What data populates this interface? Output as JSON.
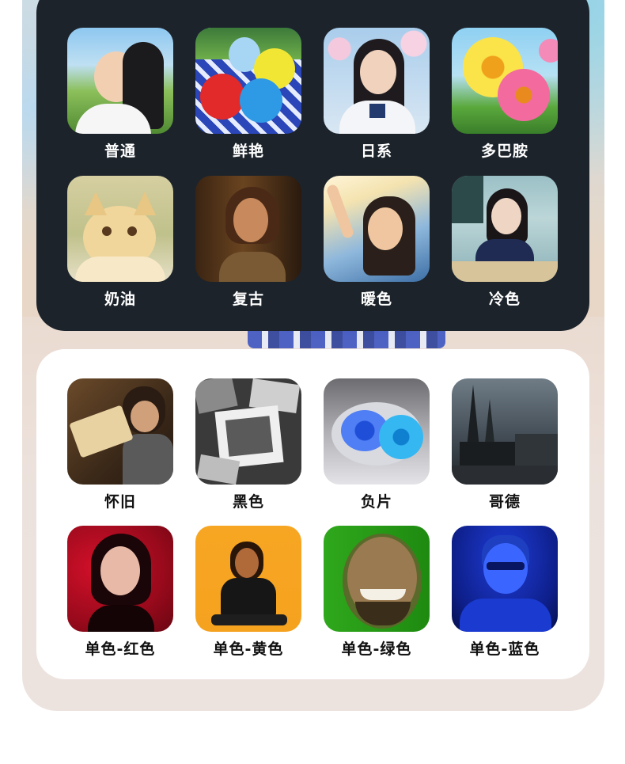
{
  "dark_section": {
    "styles": [
      {
        "label": "普通",
        "icon": "portrait-girl-field-thumbnail"
      },
      {
        "label": "鲜艳",
        "icon": "balloons-picnic-thumbnail"
      },
      {
        "label": "日系",
        "icon": "sakura-girl-thumbnail"
      },
      {
        "label": "多巴胺",
        "icon": "colorful-flowers-thumbnail"
      },
      {
        "label": "奶油",
        "icon": "cream-kitten-thumbnail"
      },
      {
        "label": "复古",
        "icon": "retro-woman-thumbnail"
      },
      {
        "label": "暖色",
        "icon": "warm-sunlight-girl-thumbnail"
      },
      {
        "label": "冷色",
        "icon": "cool-classroom-girl-thumbnail"
      }
    ]
  },
  "light_section": {
    "styles": [
      {
        "label": "怀旧",
        "icon": "nostalgic-reading-woman-thumbnail"
      },
      {
        "label": "黑色",
        "icon": "black-white-photos-thumbnail"
      },
      {
        "label": "负片",
        "icon": "negative-lemon-thumbnail"
      },
      {
        "label": "哥德",
        "icon": "gothic-cathedral-thumbnail"
      },
      {
        "label": "单色-红色",
        "icon": "mono-red-portrait-thumbnail"
      },
      {
        "label": "单色-黄色",
        "icon": "mono-yellow-portrait-thumbnail"
      },
      {
        "label": "单色-绿色",
        "icon": "mono-green-portrait-thumbnail"
      },
      {
        "label": "单色-蓝色",
        "icon": "mono-blue-portrait-thumbnail"
      }
    ]
  },
  "colors": {
    "dark_panel": "#1c232b",
    "light_panel": "#ffffff",
    "backdrop": "#ece3df"
  }
}
